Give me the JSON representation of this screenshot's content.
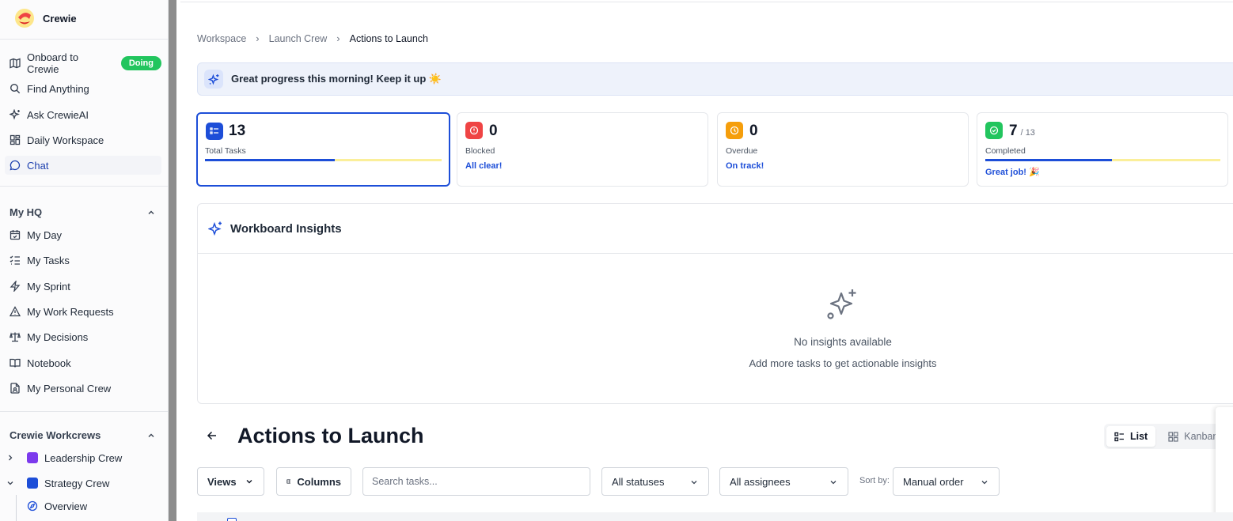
{
  "app": {
    "name": "Crewie"
  },
  "sidebar": {
    "primary": [
      {
        "label": "Onboard to Crewie",
        "icon": "map-icon",
        "badge": "Doing"
      },
      {
        "label": "Find Anything",
        "icon": "search-icon"
      },
      {
        "label": "Ask CrewieAI",
        "icon": "sparkle-icon"
      },
      {
        "label": "Daily Workspace",
        "icon": "dashboard-icon"
      },
      {
        "label": "Chat",
        "icon": "chat-icon",
        "active": true
      }
    ],
    "my_hq": {
      "title": "My HQ",
      "items": [
        {
          "label": "My Day",
          "icon": "calendar-check-icon"
        },
        {
          "label": "My Tasks",
          "icon": "list-checks-icon"
        },
        {
          "label": "My Sprint",
          "icon": "zap-icon"
        },
        {
          "label": "My Work Requests",
          "icon": "warning-icon"
        },
        {
          "label": "My Decisions",
          "icon": "scale-icon"
        },
        {
          "label": "Notebook",
          "icon": "book-icon"
        },
        {
          "label": "My Personal Crew",
          "icon": "file-user-icon"
        }
      ]
    },
    "workcrews": {
      "title": "Crewie Workcrews",
      "items": [
        {
          "label": "Leadership Crew",
          "color": "#7c3aed",
          "expanded": false
        },
        {
          "label": "Strategy Crew",
          "color": "#1d4ed8",
          "expanded": true
        }
      ],
      "sub_items": [
        {
          "label": "Overview",
          "icon": "compass-icon"
        }
      ]
    }
  },
  "breadcrumb": {
    "items": [
      "Workspace",
      "Launch Crew"
    ],
    "current": "Actions to Launch"
  },
  "banner": {
    "text": "Great progress this morning! Keep it up ☀️"
  },
  "stats": [
    {
      "value": "13",
      "label": "Total Tasks",
      "progress": 0.55,
      "icon": "list-icon",
      "color": "#1d4ed8",
      "note": ""
    },
    {
      "value": "0",
      "label": "Blocked",
      "icon": "alert-circle-icon",
      "color": "#ef4444",
      "note": "All clear!"
    },
    {
      "value": "0",
      "label": "Overdue",
      "icon": "clock-icon",
      "color": "#f59e0b",
      "note": "On track!"
    },
    {
      "value": "7",
      "of": "/ 13",
      "label": "Completed",
      "progress": 0.54,
      "icon": "check-circle-icon",
      "color": "#22c55e",
      "note": "Great job! 🎉"
    }
  ],
  "insights": {
    "title": "Workboard Insights",
    "empty_title": "No insights available",
    "empty_sub": "Add more tasks to get actionable insights"
  },
  "page": {
    "title": "Actions to Launch",
    "views": [
      "List",
      "Kanban"
    ],
    "active_view": "List"
  },
  "toolbar": {
    "views_label": "Views",
    "columns_label": "Columns",
    "search_placeholder": "Search tasks...",
    "status_filter": "All statuses",
    "assignee_filter": "All assignees",
    "sort_label": "Sort by:",
    "sort_value": "Manual order"
  }
}
